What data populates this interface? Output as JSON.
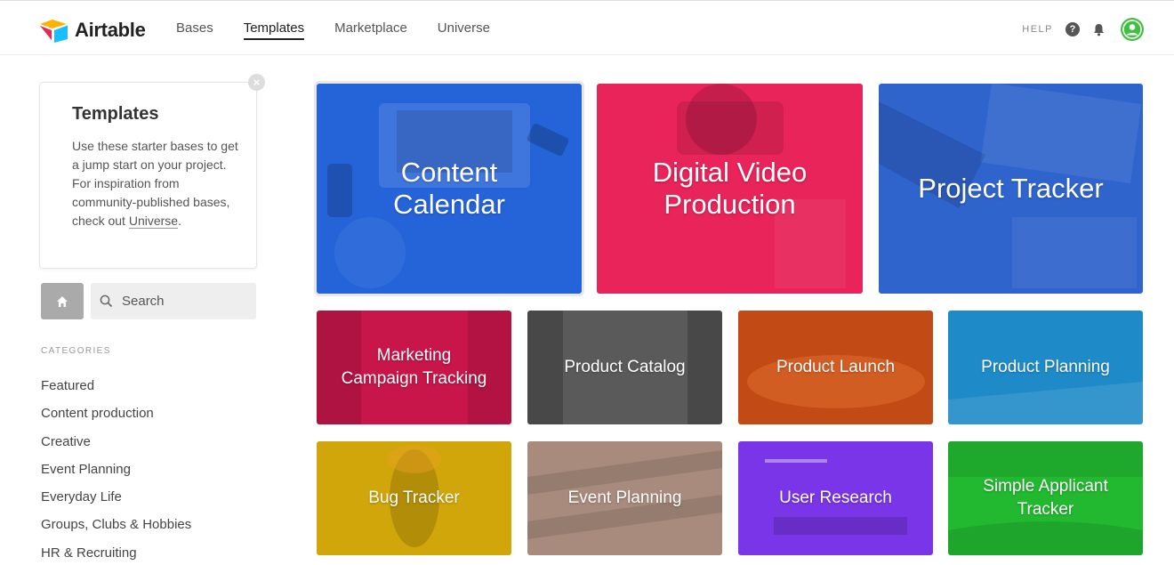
{
  "brand": {
    "name": "Airtable"
  },
  "nav": {
    "items": [
      {
        "label": "Bases",
        "active": false
      },
      {
        "label": "Templates",
        "active": true
      },
      {
        "label": "Marketplace",
        "active": false
      },
      {
        "label": "Universe",
        "active": false
      }
    ],
    "help_label": "HELP",
    "help_icon": "question-circle-icon",
    "notifications_icon": "bell-icon",
    "avatar_icon": "user-avatar-icon"
  },
  "intro": {
    "title": "Templates",
    "body": "Use these starter bases to get a jump start on your project. For inspiration from community-published bases, check out ",
    "link_text": "Universe",
    "suffix": ".",
    "close_icon": "close-icon"
  },
  "search": {
    "placeholder": "Search",
    "home_icon": "home-icon",
    "search_icon": "search-icon"
  },
  "categories": {
    "heading": "CATEGORIES",
    "items": [
      "Featured",
      "Content production",
      "Creative",
      "Event Planning",
      "Everyday Life",
      "Groups, Clubs & Hobbies",
      "HR & Recruiting"
    ]
  },
  "templates": [
    {
      "label": "Content\nCalendar",
      "color": "#2563d9",
      "size": "big"
    },
    {
      "label": "Digital Video\nProduction",
      "color": "#e8245a",
      "size": "big"
    },
    {
      "label": "Project Tracker",
      "color": "#2f64cc",
      "size": "big"
    },
    {
      "label": "Marketing\nCampaign Tracking",
      "color": "#c8164a",
      "size": "small"
    },
    {
      "label": "Product Catalog",
      "color": "#5a5a5a",
      "size": "small"
    },
    {
      "label": "Product Launch",
      "color": "#c24a14",
      "size": "small"
    },
    {
      "label": "Product Planning",
      "color": "#1e8bc8",
      "size": "small"
    },
    {
      "label": "Bug Tracker",
      "color": "#d1a60a",
      "size": "small"
    },
    {
      "label": "Event Planning",
      "color": "#a88b7c",
      "size": "small"
    },
    {
      "label": "User Research",
      "color": "#7a35e8",
      "size": "small"
    },
    {
      "label": "Simple Applicant\nTracker",
      "color": "#22b830",
      "size": "small"
    }
  ]
}
